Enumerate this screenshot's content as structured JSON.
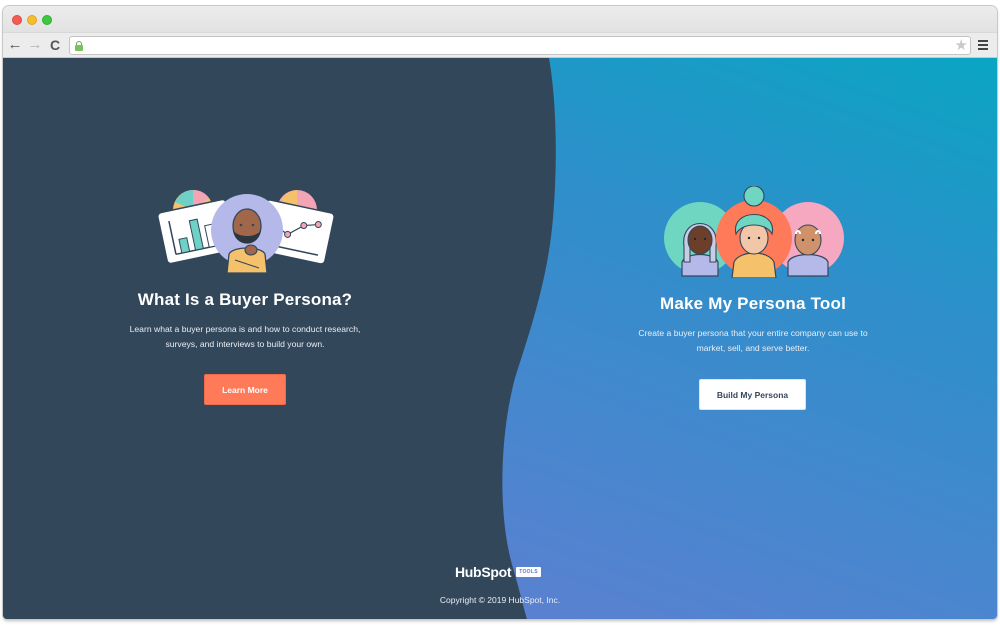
{
  "browser": {
    "url": "",
    "nav": {
      "back_icon": "←",
      "forward_icon": "→",
      "reload_icon": "C"
    },
    "star_icon": "★"
  },
  "left_panel": {
    "title": "What Is a Buyer Persona?",
    "description_line1": "Learn what a buyer persona is and how to conduct research,",
    "description_line2": "surveys, and interviews to build your own.",
    "button_label": "Learn More"
  },
  "right_panel": {
    "title": "Make My Persona Tool",
    "description_line1": "Create a buyer persona that your entire company can use to",
    "description_line2": "market, sell, and serve better.",
    "button_label": "Build My Persona"
  },
  "footer": {
    "logo_text": "HubSpot",
    "logo_tag": "TOOLS",
    "copyright": "Copyright © 2019 HubSpot, Inc."
  },
  "colors": {
    "dark_panel": "#33475b",
    "accent_orange": "#ff7a59",
    "gradient_top": "#0aa5c3",
    "gradient_bottom": "#6c7bd2"
  }
}
